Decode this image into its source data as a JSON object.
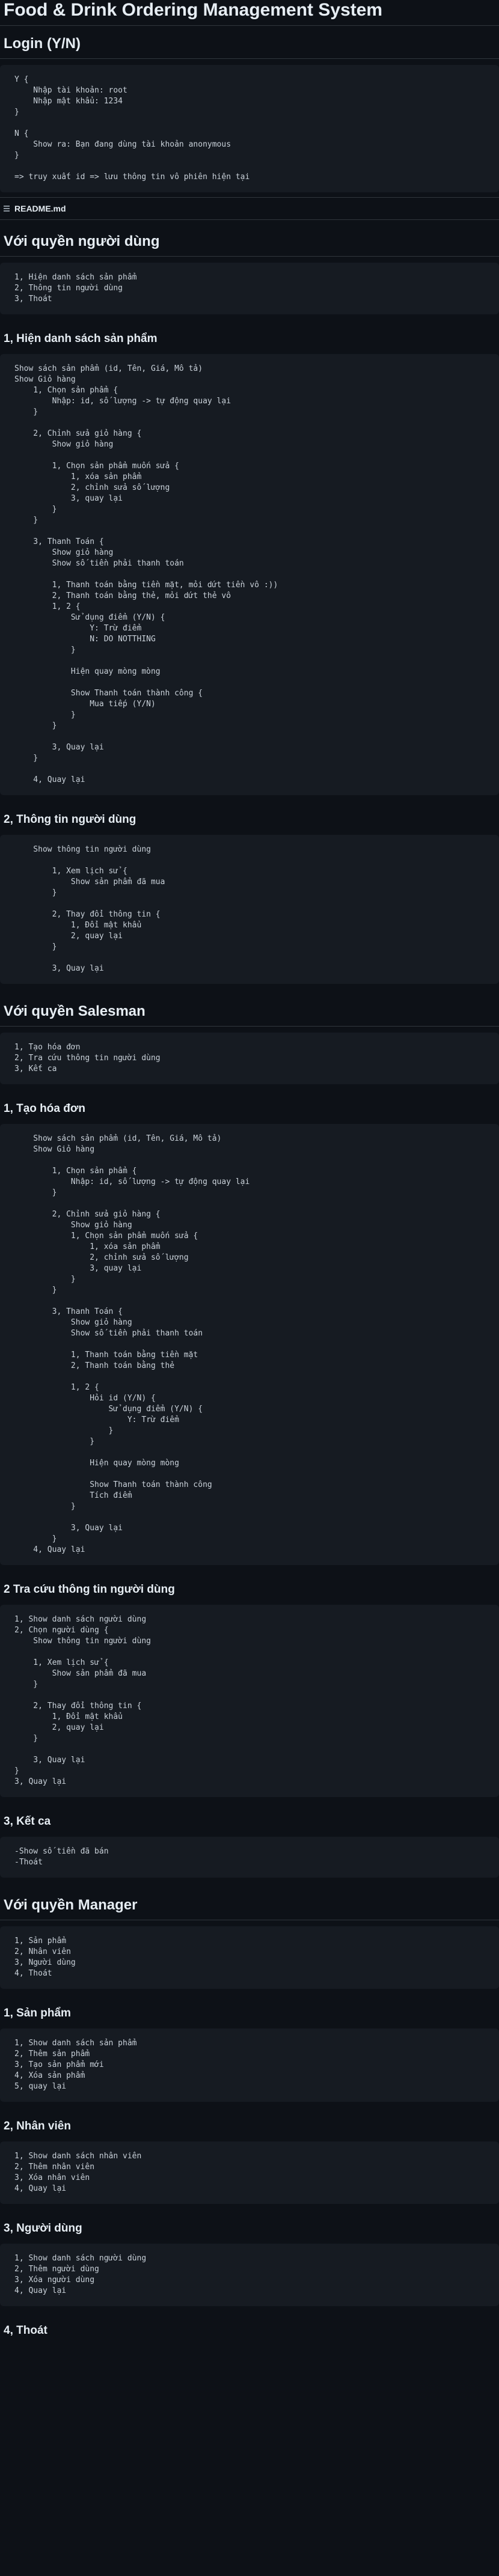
{
  "title": "Food & Drink Ordering Management System",
  "login_heading": "Login (Y/N)",
  "login_code": "Y {\n    Nhập tài khoản: root\n    Nhập mật khẩu: 1234\n}\n\nN {\n    Show ra: Bạn đang dùng tài khoản anonymous\n}\n\n=> truy xuất id => lưu thông tin vô phiên hiện tại",
  "readme": {
    "label": "README.md"
  },
  "user": {
    "heading": "Với quyền người dùng",
    "menu_code": "1, Hiện danh sách sản phẩm\n2, Thông tin người dùng\n3, Thoát",
    "products_heading": "1, Hiện danh sách sản phẩm",
    "products_code": "Show sách sản phẩm (id, Tên, Giá, Mô tả)\nShow Giỏ hàng\n    1, Chọn sản phẩm {\n        Nhập: id, số lượng -> tự động quay lại\n    }\n\n    2, Chỉnh sửa giỏ hàng {\n        Show giỏ hàng\n\n        1, Chọn sản phẩm muốn sửa {\n            1, xóa sản phẩm\n            2, chỉnh sửa số lượng\n            3, quay lại\n        }\n    }\n\n    3, Thanh Toán {\n        Show giỏ hàng\n        Show số tiền phải thanh toán\n\n        1, Thanh toán bằng tiền mặt, mỏi dứt tiền vô :))\n        2, Thanh toán bằng thẻ, mỏi dứt thẻ vô\n        1, 2 {\n            Sử dụng điểm (Y/N) {\n                Y: Trừ điểm\n                N: DO NOTTHING\n            }\n\n            Hiện quay mòng mòng\n\n            Show Thanh toán thành công {\n                Mua tiếp (Y/N)\n            }\n        }\n\n        3, Quay lại\n    }\n\n    4, Quay lại",
    "info_heading": "2, Thông tin người dùng",
    "info_code": "    Show thông tin người dùng\n\n        1, Xem lịch sử {\n            Show sản phẩm đã mua\n        }\n\n        2, Thay đổi thông tin {\n            1, Đổi mật khẩu\n            2, quay lại\n        }\n\n        3, Quay lại"
  },
  "salesman": {
    "heading": "Với quyền Salesman",
    "menu_code": "1, Tạo hóa đơn\n2, Tra cứu thông tin người dùng\n3, Kết ca",
    "invoice_heading": "1, Tạo hóa đơn",
    "invoice_code": "    Show sách sản phẩm (id, Tên, Giá, Mô tả)\n    Show Giỏ hàng\n\n        1, Chọn sản phẩm {\n            Nhập: id, số lượng -> tự động quay lại\n        }\n\n        2, Chỉnh sửa giỏ hàng {\n            Show giỏ hàng\n            1, Chọn sản phẩm muốn sửa {\n                1, xóa sản phẩm\n                2, chỉnh sửa số lượng\n                3, quay lại\n            }\n        }\n\n        3, Thanh Toán {\n            Show giỏ hàng\n            Show số tiền phải thanh toán\n\n            1, Thanh toán bằng tiền mặt\n            2, Thanh toán bằng thẻ\n\n            1, 2 {\n                Hỏi id (Y/N) {\n                    Sử dụng điểm (Y/N) {\n                        Y: Trừ điểm\n                    }\n                }\n\n                Hiện quay mòng mòng\n\n                Show Thanh toán thành công\n                Tích điểm\n            }\n\n            3, Quay lại\n        }\n    4, Quay lại",
    "lookup_heading": "2 Tra cứu thông tin người dùng",
    "lookup_code": "1, Show danh sách người dùng\n2, Chọn người dùng {\n    Show thông tin người dùng\n\n    1, Xem lịch sử {\n        Show sản phẩm đã mua\n    }\n\n    2, Thay đổi thông tin {\n        1, Đổi mật khẩu\n        2, quay lại\n    }\n\n    3, Quay lại\n}\n3, Quay lại",
    "shift_heading": "3, Kết ca",
    "shift_code": "-Show số tiền đã bán\n-Thoát"
  },
  "manager": {
    "heading": "Với quyền Manager",
    "menu_code": "1, Sản phẩm\n2, Nhân viên\n3, Người dùng\n4, Thoát",
    "products_heading": "1, Sản phẩm",
    "products_code": "1, Show danh sách sản phẩm\n2, Thêm sản phẩm\n3, Tạo sản phẩm mới\n4, Xóa sản phẩm\n5, quay lại",
    "staff_heading": "2, Nhân viên",
    "staff_code": "1, Show danh sách nhân viên\n2, Thêm nhân viên\n3, Xóa nhân viên\n4, Quay lại",
    "users_heading": "3, Người dùng",
    "users_code": "1, Show danh sách người dùng\n2, Thêm người dùng\n3, Xóa người dùng\n4, Quay lại",
    "exit_heading": "4, Thoát"
  }
}
